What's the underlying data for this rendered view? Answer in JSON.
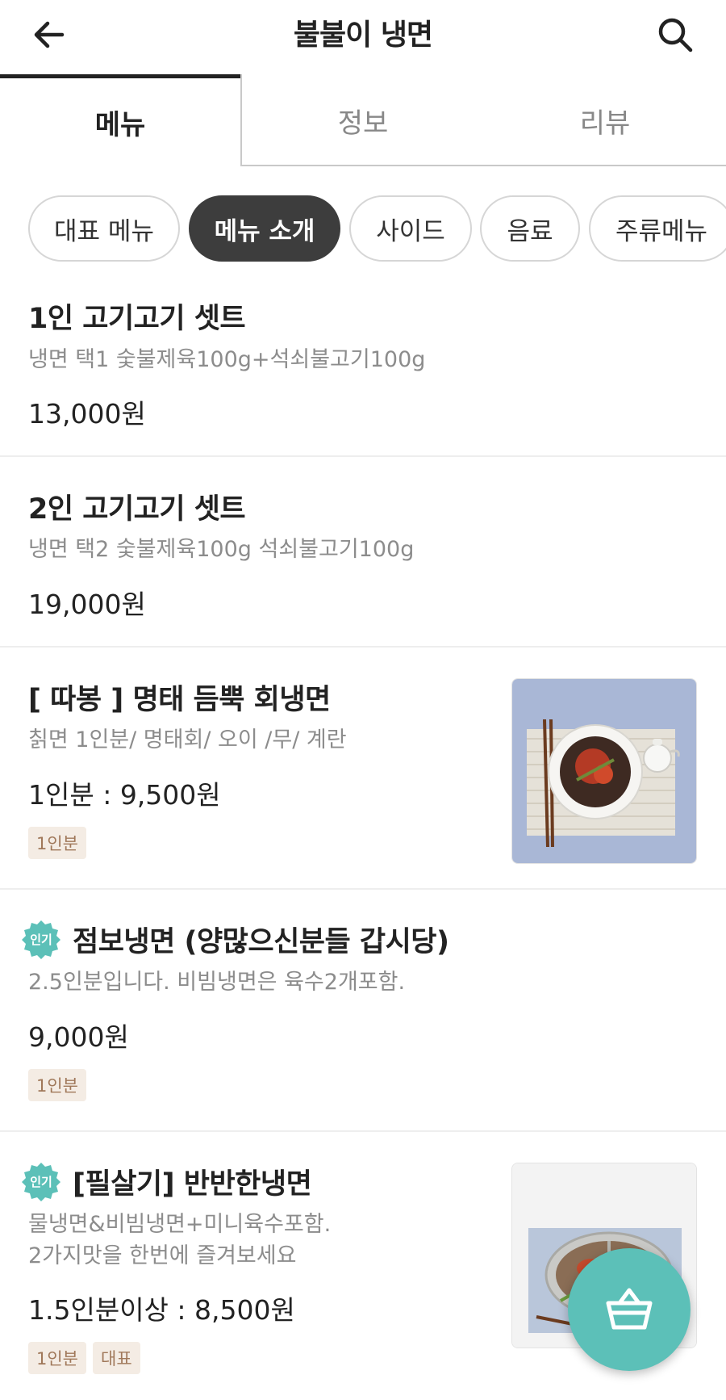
{
  "header": {
    "title": "불불이 냉면",
    "back_icon": "arrow-left-icon",
    "search_icon": "search-icon"
  },
  "tabs": [
    {
      "label": "메뉴",
      "active": true
    },
    {
      "label": "정보",
      "active": false
    },
    {
      "label": "리뷰",
      "active": false
    }
  ],
  "categories": [
    {
      "label": "대표 메뉴",
      "active": false
    },
    {
      "label": "메뉴 소개",
      "active": true
    },
    {
      "label": "사이드",
      "active": false
    },
    {
      "label": "음료",
      "active": false
    },
    {
      "label": "주류메뉴",
      "active": false
    }
  ],
  "menu_items": [
    {
      "name": "1인 고기고기 셋트",
      "desc": [
        "냉면 택1  숯불제육100g+석쇠불고기100g"
      ],
      "price": "13,000원",
      "tags": [],
      "hot": false
    },
    {
      "name": "2인 고기고기 셋트",
      "desc": [
        "냉면 택2 숯불제육100g 석쇠불고기100g"
      ],
      "price": "19,000원",
      "tags": [],
      "hot": false
    },
    {
      "name": "[ 따봉 ] 명태 듬뿍 회냉면",
      "desc": [
        "칡면 1인분/ 명태회/ 오이 /무/ 계란"
      ],
      "price": "1인분 : 9,500원",
      "tags": [
        "1인분"
      ],
      "hot": false,
      "image": "bibim-naengmyeon-photo"
    },
    {
      "name": "점보냉면 (양많으신분들 갑시당)",
      "desc": [
        "2.5인분입니다. 비빔냉면은 육수2개포함."
      ],
      "price": "9,000원",
      "tags": [
        "1인분"
      ],
      "hot": true
    },
    {
      "name": "[필살기] 반반한냉면",
      "desc": [
        "물냉면&비빔냉면+미니육수포함.",
        "2가지맛을 한번에 즐겨보세요"
      ],
      "price": "1.5인분이상 : 8,500원",
      "tags": [
        "1인분",
        "대표"
      ],
      "hot": true,
      "image": "half-half-naengmyeon-photo"
    }
  ],
  "hot_badge_label": "인기",
  "cart": {
    "icon": "shopping-basket-icon"
  },
  "colors": {
    "accent": "#5cc0b8",
    "chip_active": "#3d3d3d",
    "tag_bg": "#f4ece4",
    "tag_text": "#a0785a"
  }
}
